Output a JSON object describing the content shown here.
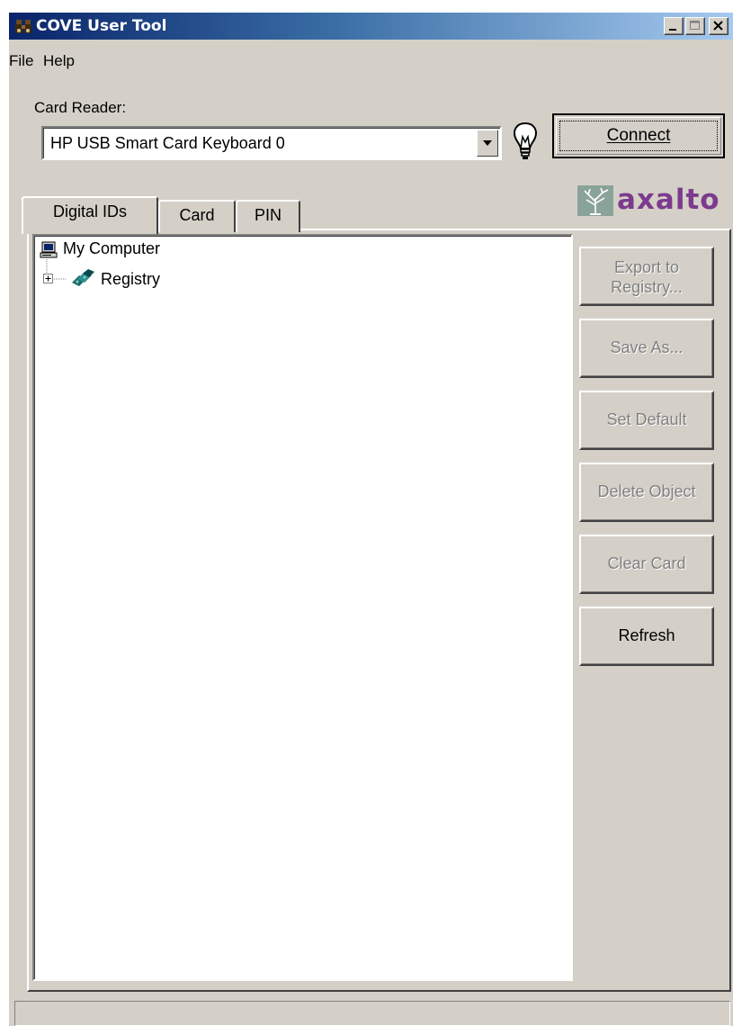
{
  "window": {
    "title": "COVE User Tool",
    "titlebar_color": "#0a246a"
  },
  "menu": {
    "items": [
      "File",
      "Help"
    ]
  },
  "reader": {
    "label": "Card Reader:",
    "selected": "HP USB Smart Card Keyboard 0",
    "connect_label": "Connect"
  },
  "logo": {
    "text": "axalto",
    "color": "#7c3b8e"
  },
  "tabs": [
    "Digital IDs",
    "Card",
    "PIN"
  ],
  "active_tab": "Digital IDs",
  "tree": {
    "root": "My Computer",
    "child": "Registry"
  },
  "actions": {
    "export_line1": "Export to",
    "export_line2": "Registry...",
    "save_as": "Save As...",
    "set_default": "Set Default",
    "delete_object": "Delete Object",
    "clear_card": "Clear Card",
    "refresh": "Refresh"
  },
  "status": {
    "text": ""
  }
}
